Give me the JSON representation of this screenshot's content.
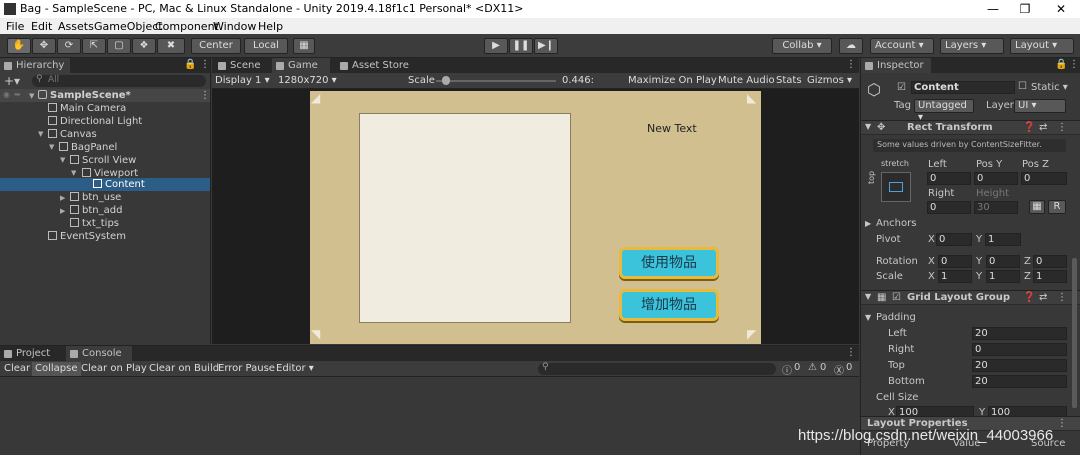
{
  "window": {
    "title": "Bag - SampleScene - PC, Mac & Linux Standalone - Unity 2019.4.18f1c1 Personal* <DX11>"
  },
  "menu": [
    "File",
    "Edit",
    "Assets",
    "GameObject",
    "Component",
    "Window",
    "Help"
  ],
  "toolbar": {
    "center": "Center",
    "local": "Local",
    "collab": "Collab",
    "account": "Account",
    "layers": "Layers",
    "layout": "Layout"
  },
  "hierarchy": {
    "title": "Hierarchy",
    "search_placeholder": "All",
    "items": [
      "SampleScene*",
      "Main Camera",
      "Directional Light",
      "Canvas",
      "BagPanel",
      "Scroll View",
      "Viewport",
      "Content",
      "btn_use",
      "btn_add",
      "txt_tips",
      "EventSystem"
    ]
  },
  "game_tabs": {
    "scene": "Scene",
    "game": "Game",
    "asset_store": "Asset Store"
  },
  "game_bar": {
    "display": "Display 1",
    "resolution": "1280x720",
    "scale_label": "Scale",
    "scale_value": "0.446:",
    "maximize": "Maximize On Play",
    "mute": "Mute Audio",
    "stats": "Stats",
    "gizmos": "Gizmos"
  },
  "scale_fraction": 0.05,
  "game_view": {
    "new_text": "New Text",
    "btn_use": "使用物品",
    "btn_add": "增加物品"
  },
  "console": {
    "tabs": {
      "project": "Project",
      "console": "Console"
    },
    "buttons": {
      "clear": "Clear",
      "collapse": "Collapse",
      "clear_on_play": "Clear on Play",
      "clear_on_build": "Clear on Build",
      "error_pause": "Error Pause",
      "editor": "Editor"
    },
    "counts": {
      "info": "0",
      "warn": "0",
      "error": "0"
    }
  },
  "inspector": {
    "title": "Inspector",
    "name": "Content",
    "static_label": "Static",
    "tag_label": "Tag",
    "tag_value": "Untagged",
    "layer_label": "Layer",
    "layer_value": "UI",
    "rect_transform": {
      "title": "Rect Transform",
      "note": "Some values driven by ContentSizeFitter.",
      "stretch": "stretch",
      "top": "top",
      "left_label": "Left",
      "left": "0",
      "posy_label": "Pos Y",
      "posy": "0",
      "posz_label": "Pos Z",
      "posz": "0",
      "right_label": "Right",
      "right": "0",
      "height_label": "Height",
      "height": "30",
      "r_btn": "R",
      "anchors": "Anchors",
      "pivot_label": "Pivot",
      "pivot_x": "0",
      "pivot_y": "1",
      "rotation_label": "Rotation",
      "rot_x": "0",
      "rot_y": "0",
      "rot_z": "0",
      "scale_label": "Scale",
      "scale_x": "1",
      "scale_y": "1",
      "scale_z": "1"
    },
    "grid": {
      "title": "Grid Layout Group",
      "padding": "Padding",
      "left_label": "Left",
      "left": "20",
      "right_label": "Right",
      "right": "0",
      "top_label": "Top",
      "top": "20",
      "bottom_label": "Bottom",
      "bottom": "20",
      "cell_size": "Cell Size",
      "cx": "100",
      "cy": "100"
    },
    "layout_props": {
      "title": "Layout Properties",
      "property": "Property",
      "value": "Value",
      "source": "Source"
    }
  },
  "watermark": "https://blog.csdn.net/weixin_44003966"
}
